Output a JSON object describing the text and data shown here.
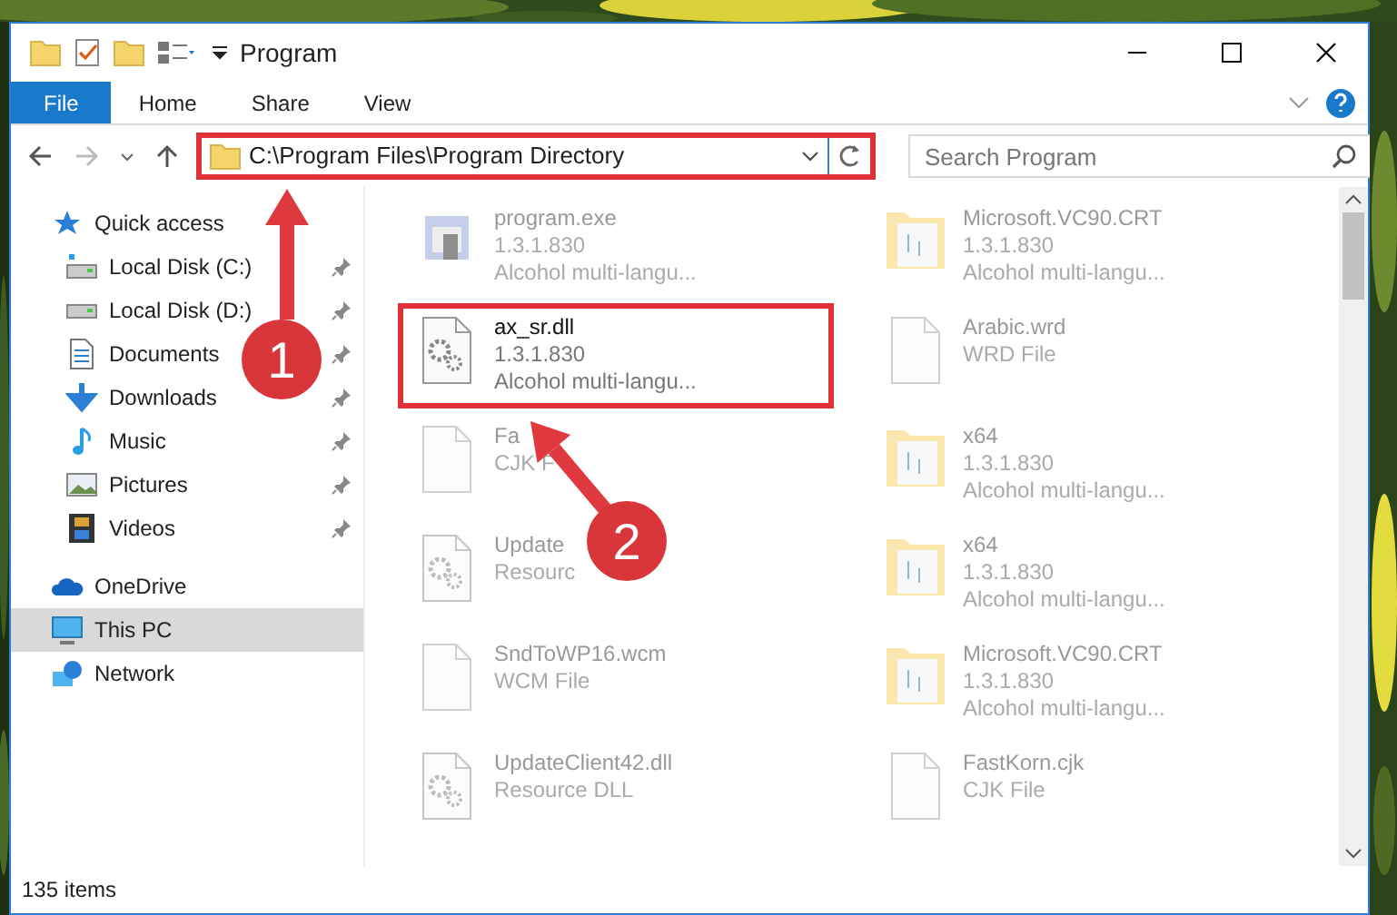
{
  "window": {
    "title": "Program"
  },
  "ribbon": {
    "tabs": [
      {
        "label": "File",
        "selected": true
      },
      {
        "label": "Home",
        "selected": false
      },
      {
        "label": "Share",
        "selected": false
      },
      {
        "label": "View",
        "selected": false
      }
    ]
  },
  "address_bar": {
    "path": "C:\\Program Files\\Program Directory",
    "highlighted": true
  },
  "search": {
    "placeholder": "Search Program"
  },
  "sidebar": {
    "items": [
      {
        "label": "Quick access",
        "kind": "star",
        "pinned": false,
        "selected": false,
        "children": [
          {
            "label": "Local Disk (C:)",
            "kind": "sysdrive",
            "pinned": true,
            "selected": false
          },
          {
            "label": "Local Disk (D:)",
            "kind": "drive",
            "pinned": true,
            "selected": false
          },
          {
            "label": "Documents",
            "kind": "documents",
            "pinned": true,
            "selected": false
          },
          {
            "label": "Downloads",
            "kind": "downloads",
            "pinned": true,
            "selected": false
          },
          {
            "label": "Music",
            "kind": "music",
            "pinned": true,
            "selected": false
          },
          {
            "label": "Pictures",
            "kind": "pictures",
            "pinned": true,
            "selected": false
          },
          {
            "label": "Videos",
            "kind": "videos",
            "pinned": true,
            "selected": false
          }
        ]
      },
      {
        "label": "OneDrive",
        "kind": "cloud",
        "pinned": false,
        "selected": false
      },
      {
        "label": "This PC",
        "kind": "pc",
        "pinned": false,
        "selected": true
      },
      {
        "label": "Network",
        "kind": "network",
        "pinned": false,
        "selected": false
      }
    ]
  },
  "files": [
    {
      "name": "program.exe",
      "lines": [
        "1.3.1.830",
        "Alcohol multi-langu..."
      ],
      "kind": "app",
      "highlighted": false,
      "dimmed": true
    },
    {
      "name": "Microsoft.VC90.CRT",
      "lines": [
        "1.3.1.830",
        "Alcohol multi-langu..."
      ],
      "kind": "folder",
      "highlighted": false,
      "dimmed": true
    },
    {
      "name": "ax_sr.dll",
      "lines": [
        "1.3.1.830",
        "Alcohol multi-langu..."
      ],
      "kind": "dll",
      "highlighted": true,
      "dimmed": false
    },
    {
      "name": "Arabic.wrd",
      "lines": [
        "WRD File"
      ],
      "kind": "file",
      "highlighted": false,
      "dimmed": true
    },
    {
      "name": "Fa",
      "lines": [
        "CJK F"
      ],
      "kind": "file",
      "highlighted": false,
      "dimmed": true
    },
    {
      "name": "x64",
      "lines": [
        "1.3.1.830",
        "Alcohol multi-langu..."
      ],
      "kind": "folder",
      "highlighted": false,
      "dimmed": true
    },
    {
      "name": "Update",
      "lines": [
        "Resourc"
      ],
      "kind": "dll",
      "highlighted": false,
      "dimmed": true
    },
    {
      "name": "x64",
      "lines": [
        "1.3.1.830",
        "Alcohol multi-langu..."
      ],
      "kind": "folder",
      "highlighted": false,
      "dimmed": true
    },
    {
      "name": "SndToWP16.wcm",
      "lines": [
        "WCM File"
      ],
      "kind": "file",
      "highlighted": false,
      "dimmed": true
    },
    {
      "name": "Microsoft.VC90.CRT",
      "lines": [
        "1.3.1.830",
        "Alcohol multi-langu..."
      ],
      "kind": "folder",
      "highlighted": false,
      "dimmed": true
    },
    {
      "name": "UpdateClient42.dll",
      "lines": [
        "Resource DLL"
      ],
      "kind": "dll",
      "highlighted": false,
      "dimmed": true
    },
    {
      "name": "FastKorn.cjk",
      "lines": [
        "CJK File"
      ],
      "kind": "file",
      "highlighted": false,
      "dimmed": true
    }
  ],
  "status_bar": {
    "count": "135 items"
  },
  "annotations": [
    {
      "number": "1"
    },
    {
      "number": "2"
    }
  ]
}
